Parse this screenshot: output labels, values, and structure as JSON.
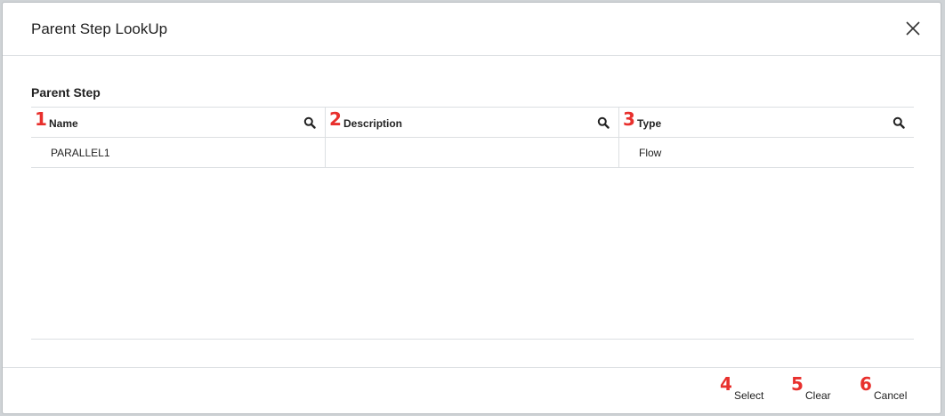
{
  "dialog": {
    "title": "Parent Step LookUp",
    "close_icon": "close-icon"
  },
  "section": {
    "label": "Parent Step"
  },
  "grid": {
    "columns": [
      {
        "marker": "1",
        "label": "Name"
      },
      {
        "marker": "2",
        "label": "Description"
      },
      {
        "marker": "3",
        "label": "Type"
      }
    ],
    "rows": [
      {
        "name": "PARALLEL1",
        "description": "",
        "type": "Flow"
      }
    ]
  },
  "footer": {
    "buttons": [
      {
        "marker": "4",
        "label": "Select"
      },
      {
        "marker": "5",
        "label": "Clear"
      },
      {
        "marker": "6",
        "label": "Cancel"
      }
    ]
  },
  "colors": {
    "marker_red": "#e8302d",
    "border": "#dcdfe2"
  }
}
